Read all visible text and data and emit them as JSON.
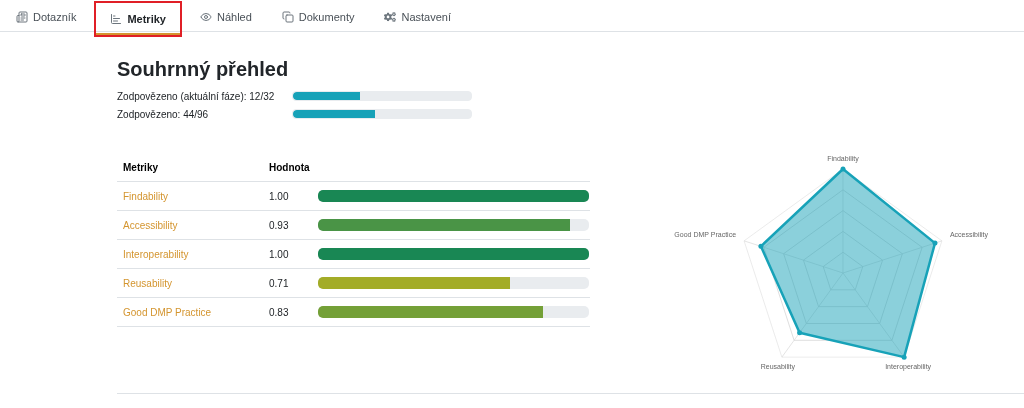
{
  "tabs": [
    {
      "label": "Dotazník",
      "selected": false,
      "highlighted": false
    },
    {
      "label": "Metriky",
      "selected": true,
      "highlighted": true
    },
    {
      "label": "Náhled",
      "selected": false,
      "highlighted": false
    },
    {
      "label": "Dokumenty",
      "selected": false,
      "highlighted": false
    },
    {
      "label": "Nastavení",
      "selected": false,
      "highlighted": false
    }
  ],
  "summary": {
    "title": "Souhrnný přehled",
    "progress": [
      {
        "label": "Zodpovězeno (aktuální fáze): 12/32",
        "level": 0.375
      },
      {
        "label": "Zodpovězeno: 44/96",
        "level": 0.458
      }
    ]
  },
  "table": {
    "columns": [
      "Metriky",
      "Hodnota"
    ],
    "rows": [
      {
        "name": "Findability",
        "value": "1.00",
        "level": 1.0,
        "color": "#198754"
      },
      {
        "name": "Accessibility",
        "value": "0.93",
        "level": 0.93,
        "color": "#4a9446"
      },
      {
        "name": "Interoperability",
        "value": "1.00",
        "level": 1.0,
        "color": "#198754"
      },
      {
        "name": "Reusability",
        "value": "0.71",
        "level": 0.71,
        "color": "#a3ac27"
      },
      {
        "name": "Good DMP Practice",
        "value": "0.83",
        "level": 0.83,
        "color": "#74a037"
      }
    ]
  },
  "radar": {
    "labels": [
      "Findability",
      "Good DMP Practice",
      "Accessibility",
      "Reusability",
      "Interoperability"
    ]
  }
}
